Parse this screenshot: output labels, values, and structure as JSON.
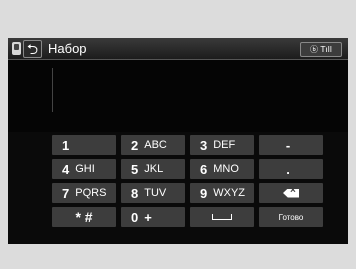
{
  "header": {
    "title": "Набор",
    "back_symbol": "⮌",
    "status_text": "ⓑ Tıll"
  },
  "keypad": {
    "rows": [
      [
        {
          "digit": "1",
          "letters": ""
        },
        {
          "digit": "2",
          "letters": "ABC"
        },
        {
          "digit": "3",
          "letters": "DEF"
        },
        {
          "digit": "-",
          "letters": ""
        }
      ],
      [
        {
          "digit": "4",
          "letters": "GHI"
        },
        {
          "digit": "5",
          "letters": "JKL"
        },
        {
          "digit": "6",
          "letters": "MNO"
        },
        {
          "digit": ".",
          "letters": ""
        }
      ],
      [
        {
          "digit": "7",
          "letters": "PQRS"
        },
        {
          "digit": "8",
          "letters": "TUV"
        },
        {
          "digit": "9",
          "letters": "WXYZ"
        },
        {
          "digit": "",
          "letters": ""
        }
      ],
      [
        {
          "digit": "* #",
          "letters": ""
        },
        {
          "digit": "0",
          "letters": "+"
        },
        {
          "digit": "",
          "letters": ""
        },
        {
          "digit": "",
          "letters": ""
        }
      ]
    ],
    "done_label": "Готово"
  }
}
